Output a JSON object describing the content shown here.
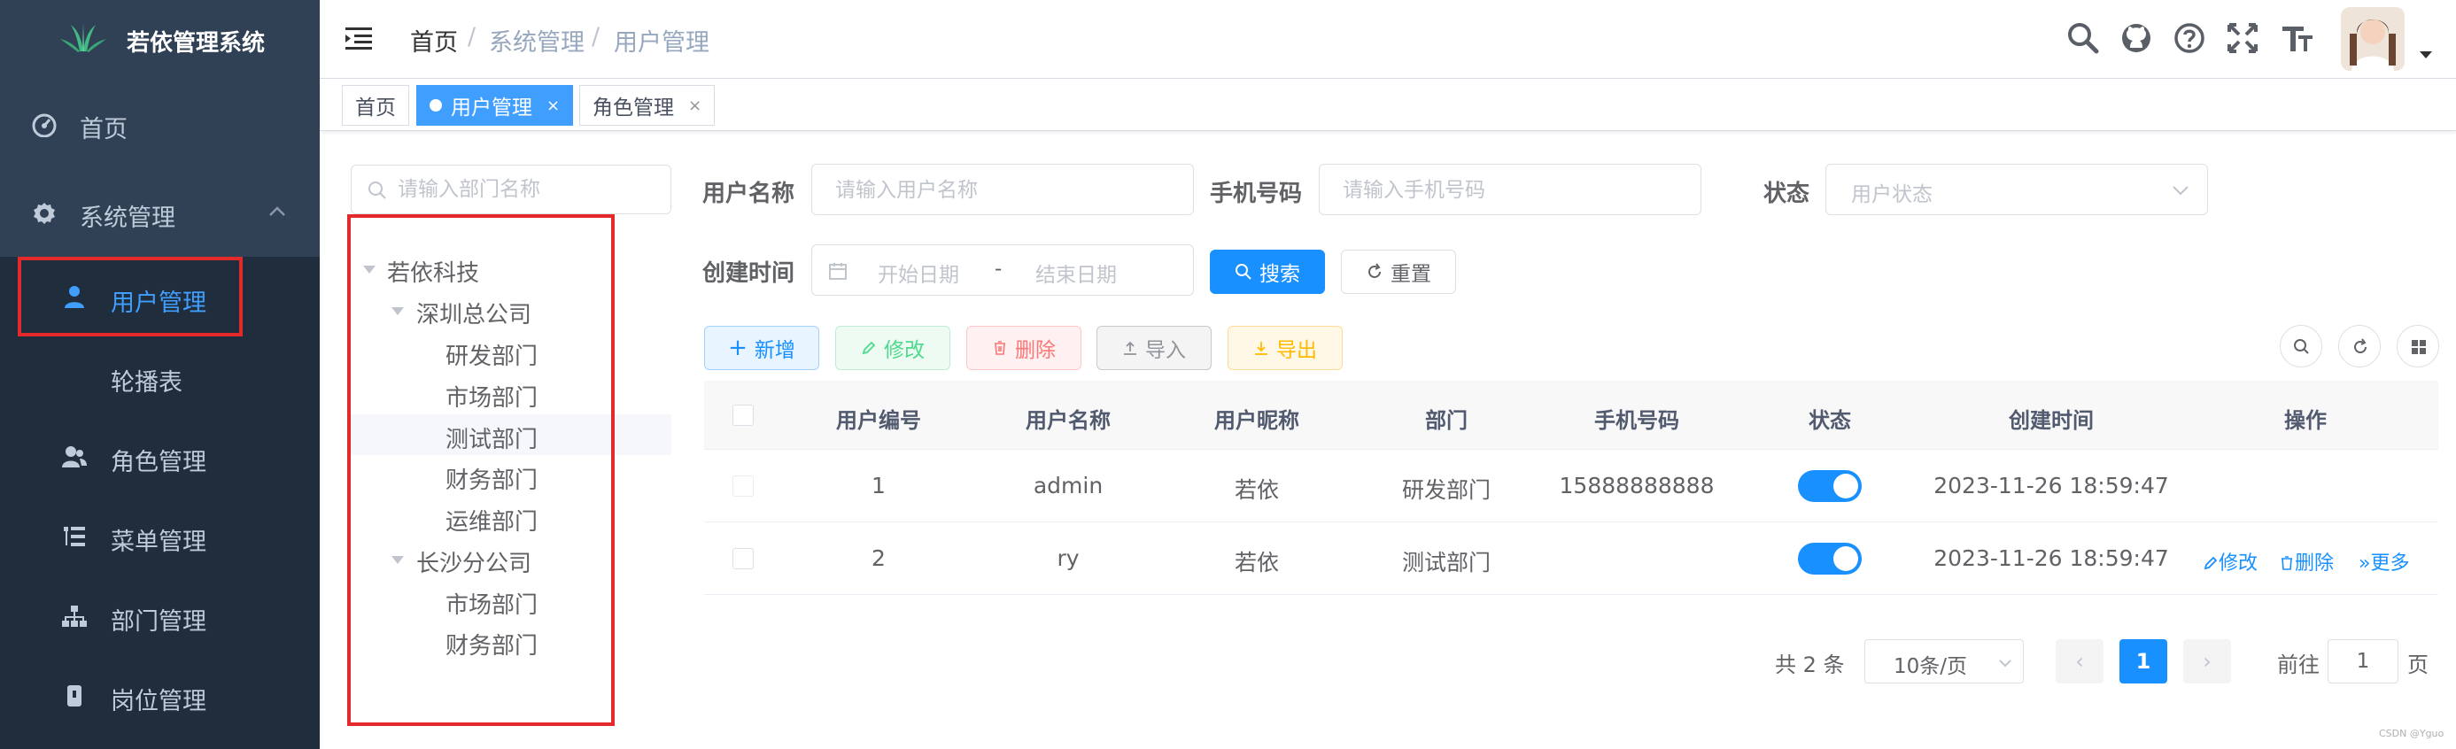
{
  "sidebar": {
    "logo_title": "若依管理系统",
    "items": [
      {
        "label": "首页",
        "icon": "dashboard-icon"
      },
      {
        "label": "系统管理",
        "icon": "gear-icon"
      },
      {
        "label": "用户管理",
        "icon": "user-icon"
      },
      {
        "label": "轮播表",
        "icon": ""
      },
      {
        "label": "角色管理",
        "icon": "peoples-icon"
      },
      {
        "label": "菜单管理",
        "icon": "tree-table-icon"
      },
      {
        "label": "部门管理",
        "icon": "tree-icon"
      },
      {
        "label": "岗位管理",
        "icon": "post-icon"
      }
    ]
  },
  "navbar": {
    "breadcrumb": [
      "首页",
      "系统管理",
      "用户管理"
    ],
    "separator": "/",
    "icons": [
      "search-icon",
      "github-icon",
      "question-icon",
      "fullscreen-icon",
      "font-size-icon"
    ]
  },
  "tags": [
    {
      "label": "首页"
    },
    {
      "label": "用户管理",
      "close": "×"
    },
    {
      "label": "角色管理",
      "close": "×"
    }
  ],
  "tree": {
    "search_placeholder": "请输入部门名称",
    "nodes": [
      "若依科技",
      "深圳总公司",
      "研发部门",
      "市场部门",
      "测试部门",
      "财务部门",
      "运维部门",
      "长沙分公司",
      "市场部门",
      "财务部门"
    ]
  },
  "filters": {
    "username_label": "用户名称",
    "username_placeholder": "请输入用户名称",
    "phone_label": "手机号码",
    "phone_placeholder": "请输入手机号码",
    "status_label": "状态",
    "status_placeholder": "用户状态",
    "created_label": "创建时间",
    "start_placeholder": "开始日期",
    "range_separator": "-",
    "end_placeholder": "结束日期",
    "search_label": "搜索",
    "reset_label": "重置"
  },
  "toolbar": {
    "add": "新增",
    "edit": "修改",
    "delete": "删除",
    "import": "导入",
    "export": "导出"
  },
  "table": {
    "headers": [
      "用户编号",
      "用户名称",
      "用户昵称",
      "部门",
      "手机号码",
      "状态",
      "创建时间",
      "操作"
    ],
    "rows": [
      {
        "id": "1",
        "username": "admin",
        "nickname": "若依",
        "dept": "研发部门",
        "phone": "15888888888",
        "status_on": true,
        "created": "2023-11-26 18:59:47"
      },
      {
        "id": "2",
        "username": "ry",
        "nickname": "若依",
        "dept": "测试部门",
        "phone": "",
        "status_on": true,
        "created": "2023-11-26 18:59:47",
        "ops": {
          "edit": "修改",
          "delete": "删除",
          "more": "更多"
        }
      }
    ]
  },
  "pagination": {
    "total_text": "共 2 条",
    "page_size": "10条/页",
    "current_page": "1",
    "jump_prefix": "前往",
    "jump_value": "1",
    "jump_suffix": "页"
  },
  "watermark": "CSDN @Yguo",
  "colors": {
    "sidebar_bg": "#304156",
    "primary": "#1890ff",
    "annotation_red": "#e4292b"
  }
}
